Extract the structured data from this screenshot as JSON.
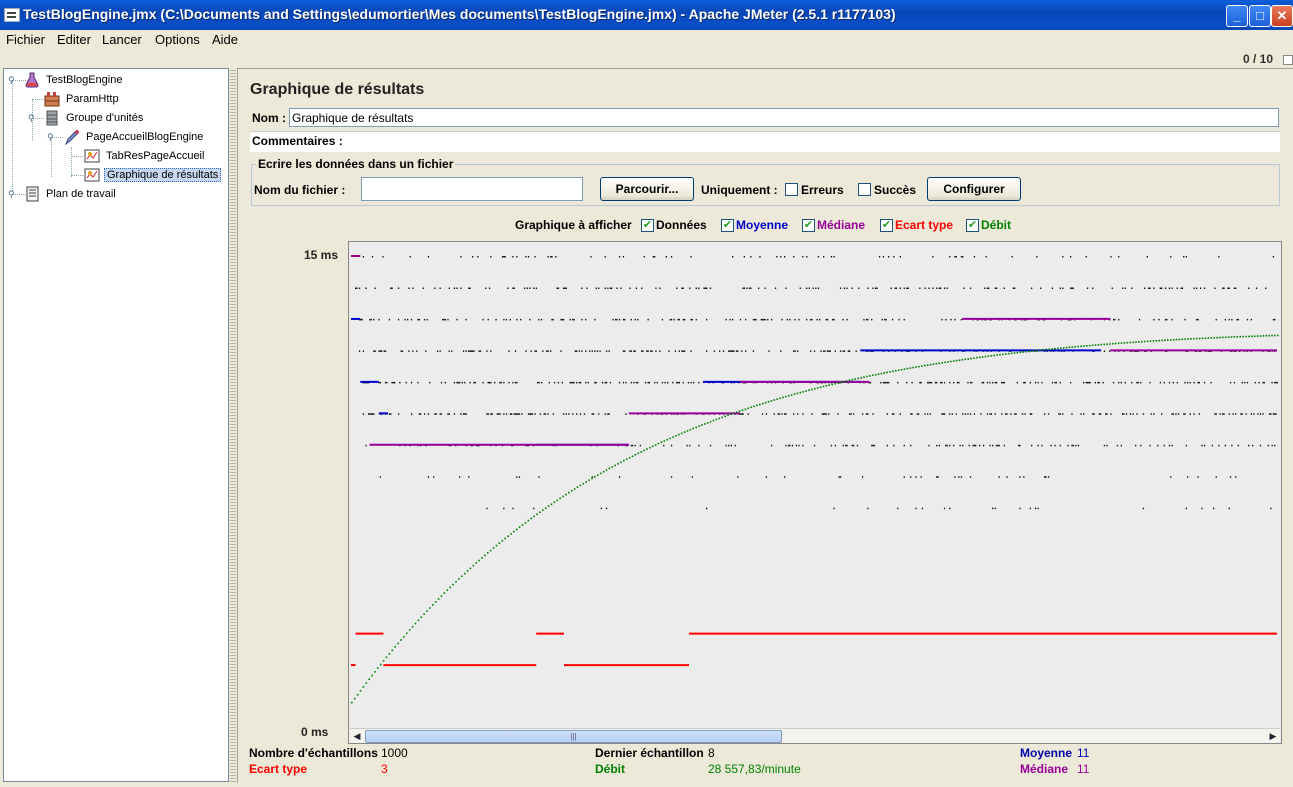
{
  "window": {
    "title": "TestBlogEngine.jmx (C:\\Documents and Settings\\edumortier\\Mes documents\\TestBlogEngine.jmx) - Apache JMeter (2.5.1 r1177103)",
    "buttons": {
      "minimize": "_",
      "maximize": "□",
      "close": "✕"
    }
  },
  "menu": [
    "Fichier",
    "Editer",
    "Lancer",
    "Options",
    "Aide"
  ],
  "counter": "0 / 10",
  "tree": [
    {
      "label": "TestBlogEngine",
      "icon": "flask-icon"
    },
    {
      "label": "ParamHttp",
      "icon": "http-config-icon"
    },
    {
      "label": "Groupe d'unités",
      "icon": "thread-group-icon"
    },
    {
      "label": "PageAccueilBlogEngine",
      "icon": "sampler-pipette-icon"
    },
    {
      "label": "TabResPageAccueil",
      "icon": "listener-icon"
    },
    {
      "label": "Graphique de résultats",
      "icon": "graph-listener-icon"
    },
    {
      "label": "Plan de travail",
      "icon": "workbench-icon"
    }
  ],
  "panel": {
    "title": "Graphique de résultats",
    "name_label": "Nom :",
    "name_value": "Graphique de résultats",
    "comments_label": "Commentaires :",
    "file_section_title": "Ecrire les données dans un fichier",
    "filename_label": "Nom du fichier :",
    "filename_value": "",
    "browse_button": "Parcourir...",
    "only_label": "Uniquement :",
    "errors_label": "Erreurs",
    "success_label": "Succès",
    "configure_button": "Configurer"
  },
  "display": {
    "label": "Graphique à afficher",
    "options": [
      {
        "label": "Données",
        "checked": true,
        "color": "#000000"
      },
      {
        "label": "Moyenne",
        "checked": true,
        "color": "#0000cc"
      },
      {
        "label": "Médiane",
        "checked": true,
        "color": "#990099"
      },
      {
        "label": "Ecart type",
        "checked": true,
        "color": "#ff0000"
      },
      {
        "label": "Débit",
        "checked": true,
        "color": "#008000"
      }
    ]
  },
  "chart_data": {
    "type": "scatter",
    "y_unit": "ms",
    "ylim": [
      0,
      15
    ],
    "y_top_label": "15  ms",
    "y_bottom_label": "0  ms",
    "samples": 1000,
    "series": [
      {
        "name": "Moyenne",
        "color": "#0000cc",
        "segments": [
          [
            0,
            1,
            13
          ],
          [
            1,
            3,
            11
          ],
          [
            3,
            4,
            10
          ],
          [
            20,
            30,
            9
          ],
          [
            38,
            55,
            11
          ],
          [
            55,
            81,
            12
          ]
        ]
      },
      {
        "name": "Médiane",
        "color": "#990099",
        "segments": [
          [
            0,
            1,
            15
          ],
          [
            2,
            30,
            9
          ],
          [
            30,
            42,
            10
          ],
          [
            42,
            56,
            11
          ],
          [
            66,
            82,
            13
          ],
          [
            82,
            100,
            12
          ]
        ]
      },
      {
        "name": "Ecart type",
        "color": "#ff0000",
        "segments": [
          [
            0,
            0.5,
            2
          ],
          [
            0.5,
            3.5,
            3
          ],
          [
            3.5,
            20,
            2
          ],
          [
            20,
            23,
            3
          ],
          [
            23,
            36.5,
            2
          ],
          [
            36.5,
            100,
            3
          ]
        ]
      },
      {
        "name": "Débit",
        "color": "#008000",
        "curve": "rising to ~13 units"
      }
    ]
  },
  "stats": {
    "samples_label": "Nombre d'échantillons",
    "samples_value": "1000",
    "last_label": "Dernier échantillon",
    "last_value": "8",
    "mean_label": "Moyenne",
    "mean_value": "11",
    "std_label": "Ecart type",
    "std_value": "3",
    "throughput_label": "Débit",
    "throughput_value": "28 557,83/minute",
    "median_label": "Médiane",
    "median_value": "11"
  }
}
